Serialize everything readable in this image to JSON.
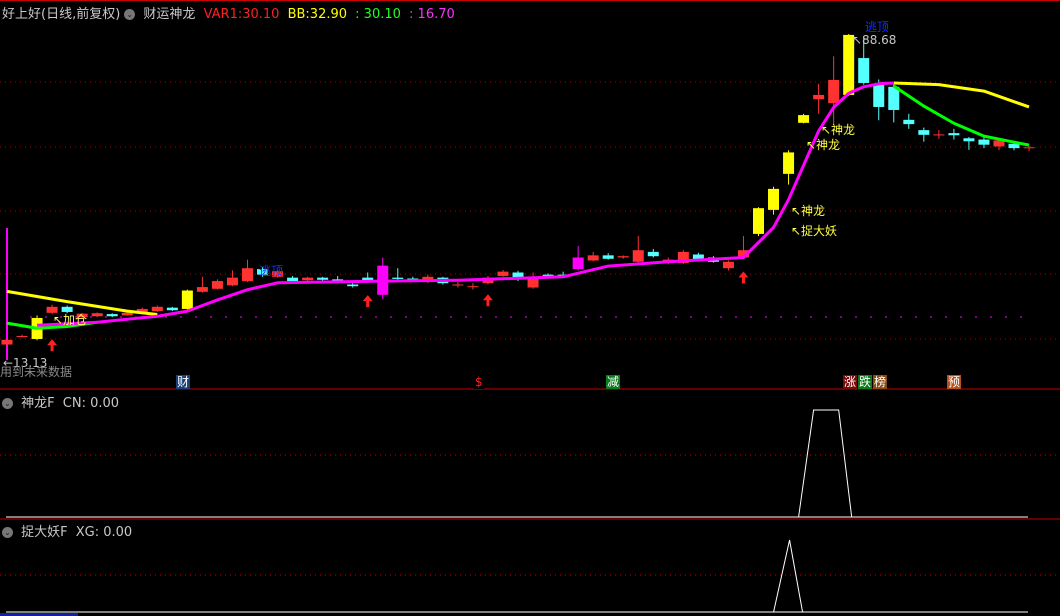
{
  "header": {
    "stock": "好上好(日线,前复权)",
    "indicator": "财运神龙",
    "var1_label": "VAR1:",
    "var1_value": "30.10",
    "bb_label": "BB:",
    "bb_value": "32.90",
    "v3": ": 30.10",
    "v4": ": 16.70"
  },
  "main": {
    "annotations": {
      "escape_top_1": "逃顶",
      "escape_top_2": "逃顶",
      "add_position": "↖加仓",
      "dragon_1": "↖神龙",
      "dragon_2": "↖神龙",
      "dragon_3": "↖神龙",
      "catch_demon": "↖捉大妖",
      "high_label": "↖88.68",
      "low_label": "←13.13",
      "future_data": "用到未来数据"
    },
    "tags": [
      {
        "text": "财",
        "color": "#1a3f7a"
      },
      {
        "text": "$",
        "color": "#000000"
      },
      {
        "text": "减",
        "color": "#0a7a1a"
      },
      {
        "text": "涨",
        "color": "#7a0a0a"
      },
      {
        "text": "跌",
        "color": "#0a7a1a"
      },
      {
        "text": "榜",
        "color": "#8a4a10"
      },
      {
        "text": "预",
        "color": "#b8501a"
      }
    ],
    "colors": {
      "up": "#ff3232",
      "down": "#54ffff",
      "signal": "#ffff00",
      "special": "#ff00ff",
      "ma_main": "#ff00ff",
      "ma_upper": "#ffff00",
      "ma_lower": "#00ff00"
    }
  },
  "panel1": {
    "title": "神龙F",
    "value_label": "CN: 0.00"
  },
  "panel2": {
    "title": "捉大妖F",
    "value_label": "XG: 0.00"
  },
  "chart_data": {
    "type": "candlestick",
    "price_range": [
      13.13,
      88.68
    ],
    "candles": [
      [
        18.3,
        17.2,
        18.6,
        16.8,
        "u"
      ],
      [
        19.1,
        19.2,
        19.5,
        18.9,
        "u"
      ],
      [
        18.5,
        23.4,
        24.0,
        18.2,
        "y"
      ],
      [
        24.6,
        26.0,
        26.5,
        24.3,
        "u"
      ],
      [
        26.0,
        24.8,
        26.3,
        24.5,
        "d"
      ],
      [
        23.6,
        24.4,
        24.6,
        23.4,
        "u"
      ],
      [
        23.8,
        24.5,
        24.7,
        23.6,
        "u"
      ],
      [
        24.3,
        23.8,
        24.5,
        23.6,
        "d"
      ],
      [
        24.0,
        24.6,
        24.8,
        23.9,
        "u"
      ],
      [
        24.5,
        25.5,
        25.8,
        24.3,
        "u"
      ],
      [
        25.0,
        26.0,
        26.3,
        24.8,
        "u"
      ],
      [
        25.8,
        25.2,
        26.0,
        25.0,
        "d"
      ],
      [
        25.5,
        29.8,
        30.0,
        25.3,
        "y"
      ],
      [
        29.5,
        30.6,
        33.0,
        29.3,
        "u"
      ],
      [
        30.2,
        32.0,
        32.4,
        30.0,
        "u"
      ],
      [
        31.0,
        32.8,
        34.5,
        30.8,
        "u"
      ],
      [
        32.0,
        35.0,
        37.0,
        31.8,
        "u"
      ],
      [
        34.8,
        33.5,
        35.2,
        33.0,
        "d"
      ],
      [
        33.0,
        34.3,
        34.6,
        32.8,
        "u"
      ],
      [
        32.8,
        32.0,
        33.2,
        31.8,
        "d"
      ],
      [
        32.2,
        32.8,
        33.0,
        32.0,
        "u"
      ],
      [
        32.8,
        32.3,
        33.0,
        32.0,
        "d"
      ],
      [
        32.4,
        32.0,
        33.2,
        31.5,
        "d"
      ],
      [
        31.2,
        30.8,
        31.5,
        30.5,
        "d"
      ],
      [
        32.0,
        32.8,
        34.0,
        31.8,
        "d"
      ],
      [
        35.6,
        28.8,
        37.5,
        27.8,
        "m"
      ],
      [
        32.5,
        32.8,
        35.0,
        32.3,
        "d"
      ],
      [
        32.5,
        32.6,
        33.0,
        32.2,
        "d"
      ],
      [
        31.8,
        33.0,
        33.5,
        31.5,
        "u"
      ],
      [
        32.8,
        31.5,
        33.0,
        31.2,
        "d"
      ],
      [
        31.2,
        31.0,
        31.8,
        30.5,
        "u"
      ],
      [
        30.8,
        30.6,
        31.5,
        30.0,
        "u"
      ],
      [
        31.5,
        32.8,
        33.2,
        31.2,
        "u"
      ],
      [
        33.2,
        34.2,
        34.6,
        33.0,
        "u"
      ],
      [
        34.0,
        32.5,
        34.4,
        32.0,
        "d"
      ],
      [
        32.8,
        30.5,
        34.0,
        30.2,
        "u"
      ],
      [
        33.2,
        33.5,
        33.8,
        33.0,
        "d"
      ],
      [
        33.0,
        33.5,
        34.2,
        32.8,
        "d"
      ],
      [
        34.8,
        37.5,
        40.2,
        34.5,
        "m"
      ],
      [
        36.8,
        38.0,
        38.8,
        36.6,
        "u"
      ],
      [
        38.0,
        37.2,
        38.5,
        37.0,
        "d"
      ],
      [
        37.5,
        37.8,
        38.0,
        37.2,
        "u"
      ],
      [
        36.5,
        39.2,
        42.5,
        36.2,
        "u"
      ],
      [
        37.8,
        38.8,
        39.5,
        37.5,
        "d"
      ],
      [
        37.0,
        36.2,
        37.5,
        36.0,
        "u"
      ],
      [
        38.8,
        36.2,
        39.2,
        36.0,
        "u"
      ],
      [
        37.0,
        38.2,
        38.6,
        36.8,
        "d"
      ],
      [
        37.5,
        36.5,
        37.8,
        36.3,
        "d"
      ],
      [
        36.5,
        35.0,
        36.8,
        34.5,
        "u"
      ],
      [
        37.5,
        39.2,
        42.5,
        37.2,
        "u"
      ],
      [
        43.0,
        49.0,
        49.2,
        42.5,
        "y"
      ],
      [
        48.6,
        53.5,
        54.0,
        47.5,
        "y"
      ],
      [
        57.0,
        62.0,
        62.5,
        54.5,
        "y"
      ],
      [
        68.9,
        70.7,
        71.0,
        68.8,
        "y"
      ],
      [
        74.4,
        75.4,
        78.0,
        71.0,
        "u"
      ],
      [
        73.5,
        78.9,
        84.4,
        68.4,
        "u"
      ],
      [
        75.4,
        89.4,
        89.6,
        75.2,
        "y"
      ],
      [
        84.0,
        78.2,
        88.7,
        77.8,
        "d"
      ],
      [
        77.8,
        72.6,
        79.0,
        69.5,
        "d"
      ],
      [
        77.3,
        71.9,
        78.0,
        69.0,
        "d"
      ],
      [
        69.6,
        68.6,
        71.0,
        67.5,
        "d"
      ],
      [
        67.2,
        66.1,
        67.8,
        64.5,
        "d"
      ],
      [
        66.2,
        66.1,
        67.2,
        65.2,
        "u"
      ],
      [
        66.5,
        66.0,
        67.5,
        65.0,
        "d"
      ],
      [
        65.3,
        64.6,
        65.6,
        62.6,
        "d"
      ],
      [
        65.0,
        63.8,
        65.5,
        63.0,
        "d"
      ],
      [
        64.8,
        63.4,
        65.0,
        62.5,
        "u"
      ],
      [
        64.0,
        63.0,
        64.5,
        62.5,
        "d"
      ],
      [
        63.2,
        63.1,
        63.5,
        62.3,
        "u"
      ]
    ],
    "ma_main": [
      [
        2,
        21.7
      ],
      [
        6,
        22.4
      ],
      [
        10,
        23.8
      ],
      [
        12,
        25.0
      ],
      [
        14,
        27.6
      ],
      [
        16,
        30.0
      ],
      [
        18,
        31.6
      ],
      [
        25,
        32.0
      ],
      [
        30,
        32.2
      ],
      [
        37,
        33.0
      ],
      [
        40,
        35.5
      ],
      [
        44,
        36.5
      ],
      [
        49,
        37.5
      ],
      [
        50,
        41.0
      ],
      [
        51,
        44.5
      ],
      [
        52,
        51.0
      ],
      [
        53,
        59.0
      ],
      [
        54,
        67.0
      ],
      [
        55,
        72.5
      ],
      [
        56,
        75.8
      ],
      [
        57,
        77.3
      ],
      [
        58,
        78.0
      ],
      [
        59,
        78.2
      ]
    ],
    "ma_upper": [
      [
        0,
        29.6
      ],
      [
        4,
        27.2
      ],
      [
        8,
        25.0
      ],
      [
        10,
        24.2
      ],
      [
        59,
        78.2
      ],
      [
        62,
        77.8
      ],
      [
        65,
        76.3
      ],
      [
        68,
        72.6
      ]
    ],
    "ma_lower": [
      [
        0,
        22.2
      ],
      [
        2,
        21.0
      ],
      [
        4,
        21.4
      ],
      [
        6,
        22.4
      ],
      [
        59,
        77.5
      ],
      [
        61,
        72.8
      ],
      [
        63,
        68.8
      ],
      [
        65,
        65.8
      ],
      [
        68,
        63.7
      ]
    ],
    "arrows": [
      3,
      24,
      32,
      49
    ],
    "panel1_signal": {
      "type": "step",
      "active_range": [
        53,
        56
      ],
      "value": 1
    },
    "panel2_signal": {
      "type": "spike",
      "peak_index": 52,
      "value": 1
    }
  }
}
